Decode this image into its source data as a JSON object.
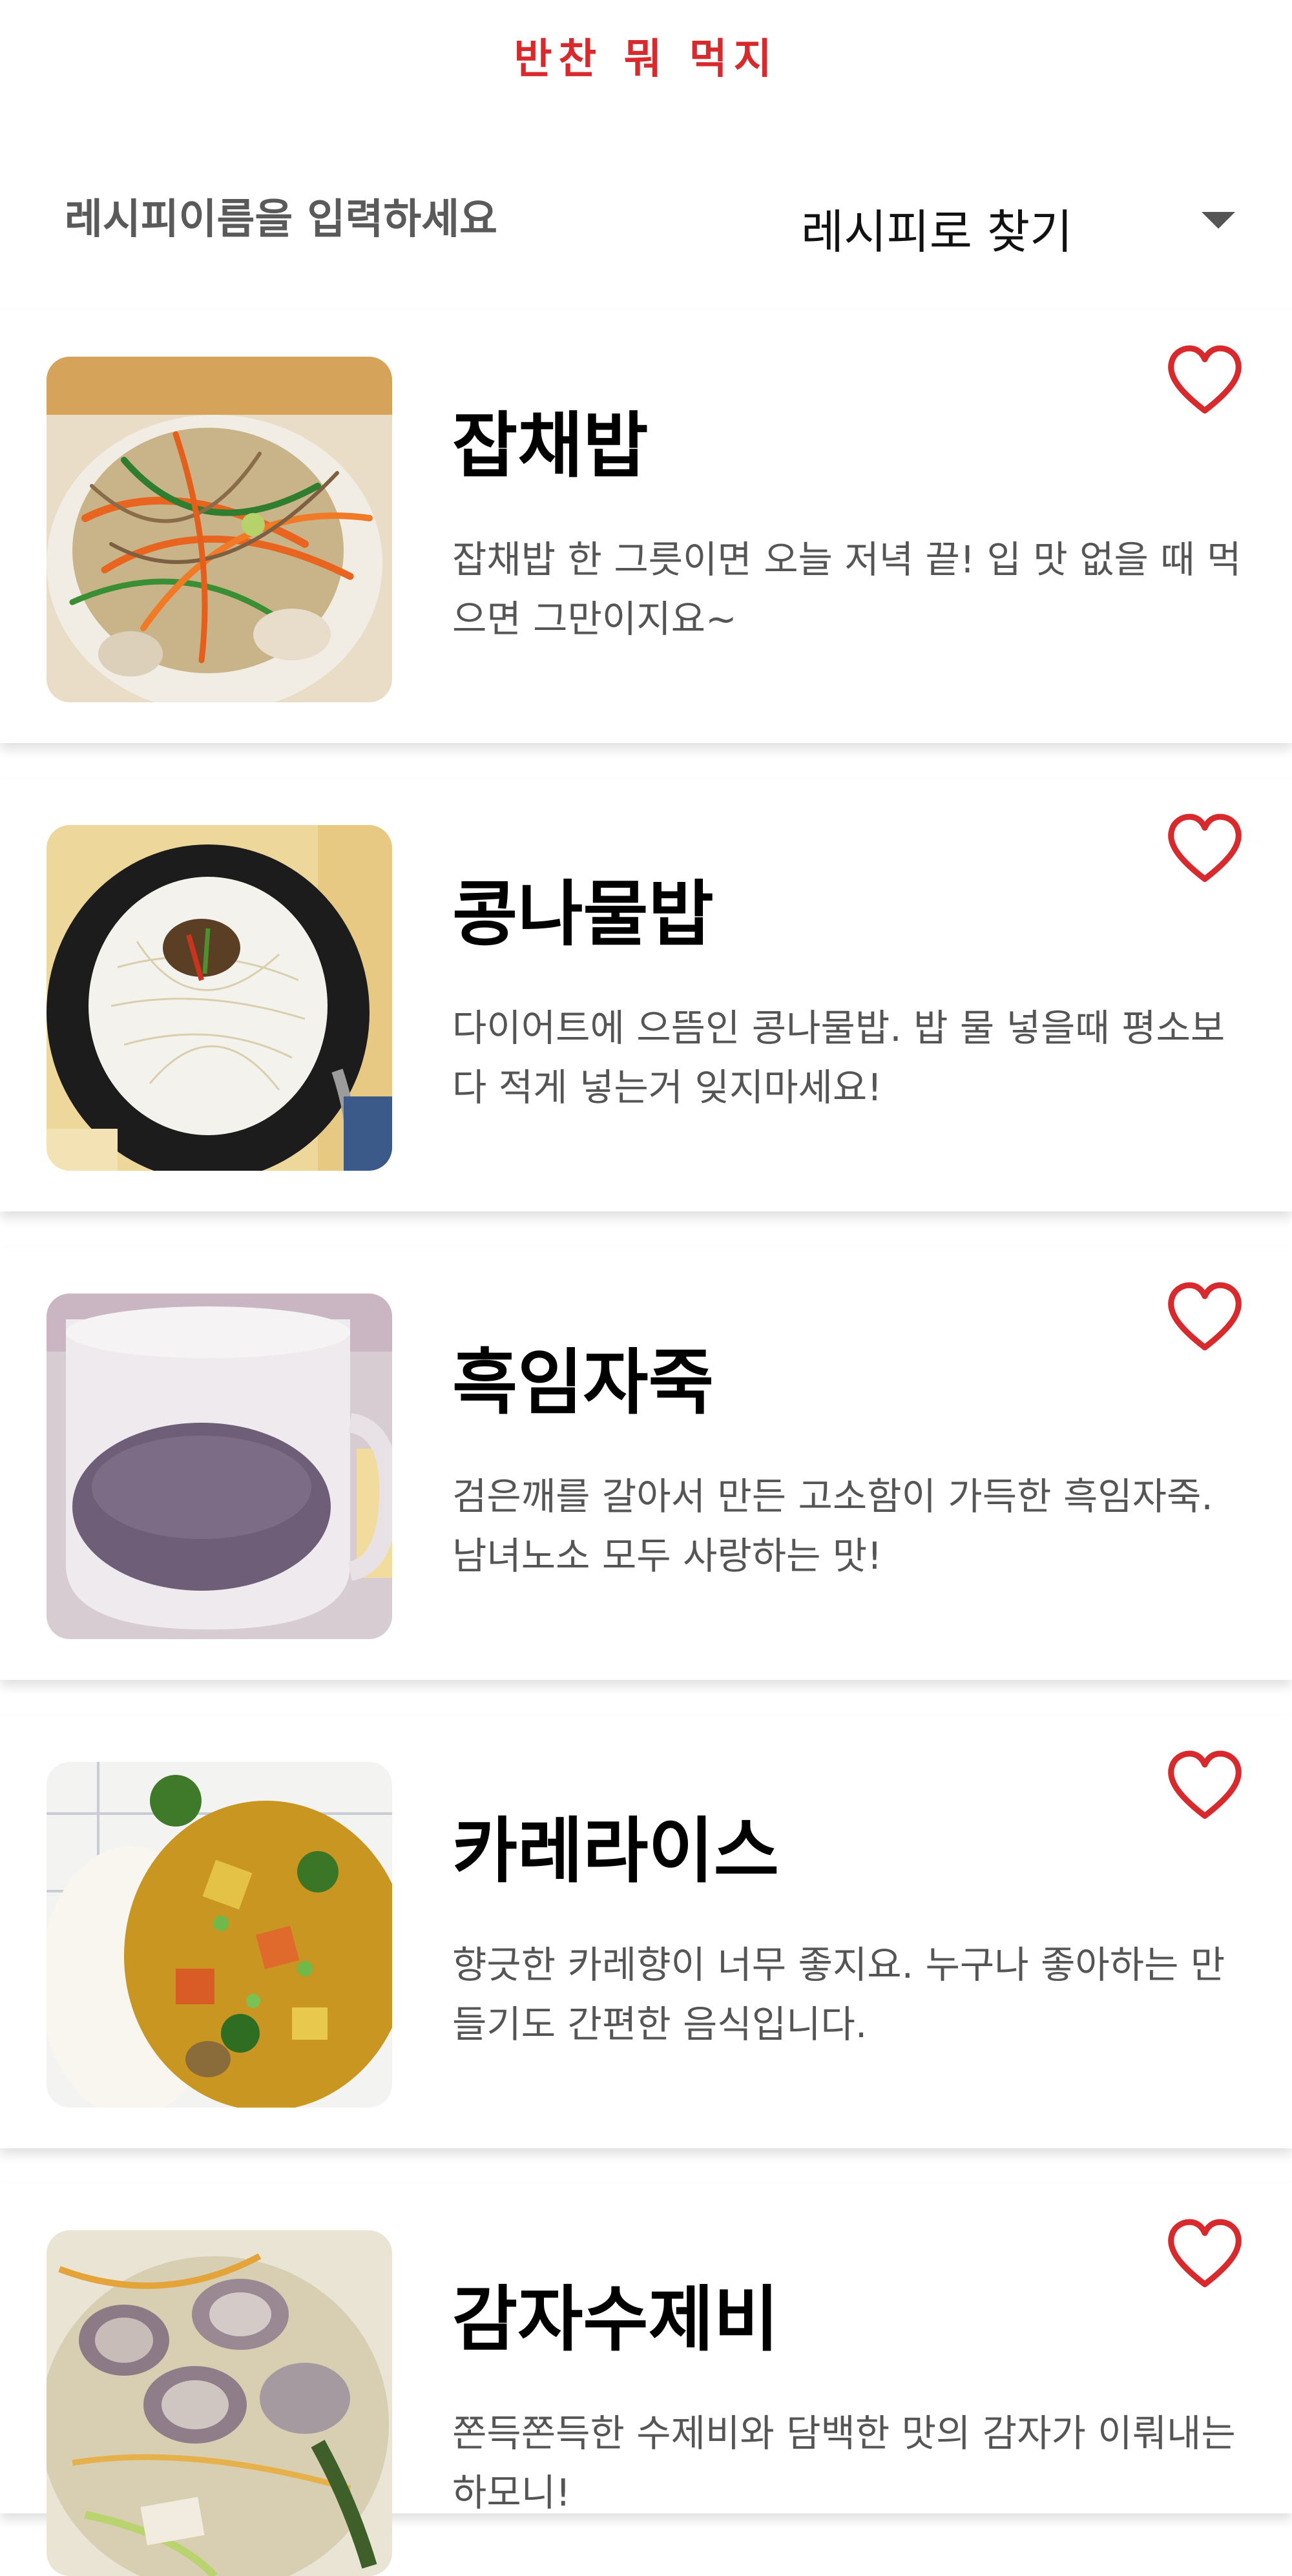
{
  "app": {
    "title": "반찬 뭐 먹지"
  },
  "search": {
    "placeholder": "레시피이름을 입력하세요",
    "value": "",
    "mode_label": "레시피로 찾기"
  },
  "icons": {
    "dropdown": "chevron-down-icon",
    "favorite": "heart-outline-icon"
  },
  "colors": {
    "brand": "#d8292d",
    "heart": "#d8292d",
    "title": "#000000",
    "description": "#555555"
  },
  "recipes": [
    {
      "title": "잡채밥",
      "description": "잡채밥 한 그릇이면 오늘 저녁 끝! 입 맛 없을 때 먹으면 그만이지요~"
    },
    {
      "title": "콩나물밥",
      "description": "다이어트에 으뜸인 콩나물밥. 밥 물 넣을때 평소보다 적게 넣는거 잊지마세요!"
    },
    {
      "title": "흑임자죽",
      "description": "검은깨를 갈아서 만든 고소함이 가득한 흑임자죽. 남녀노소 모두 사랑하는 맛!"
    },
    {
      "title": "카레라이스",
      "description": "향긋한 카레향이 너무 좋지요. 누구나 좋아하는 만들기도 간편한 음식입니다."
    },
    {
      "title": "감자수제비",
      "description": "쫀득쫀득한 수제비와 담백한 맛의 감자가 이뤄내는 하모니!"
    }
  ]
}
